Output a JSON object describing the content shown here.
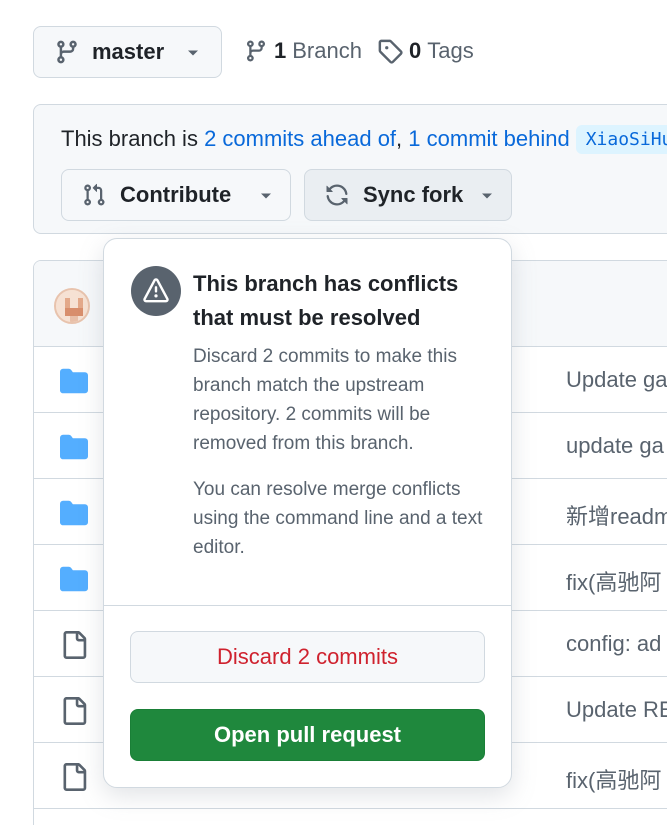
{
  "branch_selector": {
    "label": "master"
  },
  "branches": {
    "count": "1",
    "label": "Branch"
  },
  "tags": {
    "count": "0",
    "label": "Tags"
  },
  "fork_status": {
    "prefix": "This branch is ",
    "ahead_link": "2 commits ahead of",
    "separator": ", ",
    "behind_link": "1 commit behind",
    "upstream": "XiaoSiHu"
  },
  "buttons": {
    "contribute": "Contribute",
    "sync_fork": "Sync fork"
  },
  "files": [
    {
      "type": "folder",
      "message": "Update ga"
    },
    {
      "type": "folder",
      "message": "update ga"
    },
    {
      "type": "folder",
      "message": "新增readm"
    },
    {
      "type": "folder",
      "message": "fix(高驰阿"
    },
    {
      "type": "file",
      "message": "config: ad"
    },
    {
      "type": "file",
      "message": "Update RE"
    },
    {
      "type": "file",
      "message": "fix(高驰阿"
    }
  ],
  "popover": {
    "title": "This branch has conflicts that must be resolved",
    "description": "Discard 2 commits to make this branch match the upstream repository. 2 commits will be removed from this branch.",
    "note": "You can resolve merge conflicts using the command line and a text editor.",
    "discard_button": "Discard 2 commits",
    "open_pr_button": "Open pull request"
  },
  "colors": {
    "link": "#0969da",
    "danger": "#cf222e",
    "primary": "#1f883d",
    "muted": "#59636e",
    "folder": "#54aeff"
  },
  "icons": [
    "git-branch-icon",
    "chevron-down-icon",
    "tag-icon",
    "git-pull-request-icon",
    "sync-icon",
    "alert-icon",
    "folder-icon",
    "file-icon"
  ]
}
